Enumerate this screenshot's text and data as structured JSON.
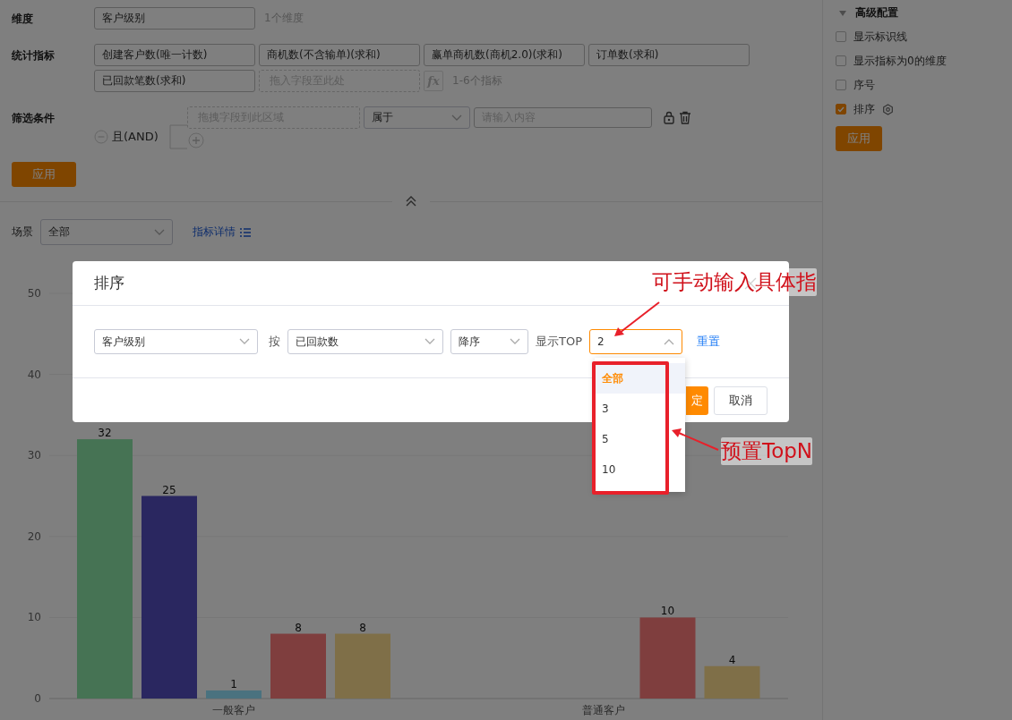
{
  "config": {
    "dimension": {
      "label": "维度",
      "tags": [
        "客户级别"
      ],
      "hint": "1个维度"
    },
    "metrics": {
      "label": "统计指标",
      "tags": [
        "创建客户数(唯一计数)",
        "商机数(不含输单)(求和)",
        "赢单商机数(商机2.0)(求和)",
        "订单数(求和)",
        "已回款笔数(求和)"
      ],
      "placeholder": "拖入字段至此处",
      "formula": "fx",
      "hint": "1-6个指标"
    },
    "filter": {
      "label": "筛选条件",
      "logic": "且(AND)",
      "conditions": [
        {
          "field_placeholder": "拖拽字段到此区域",
          "operator": "属于",
          "value_placeholder": "请输入内容"
        }
      ]
    },
    "apply": "应用"
  },
  "scene": {
    "label": "场景",
    "value": "全部",
    "link": "指标详情"
  },
  "chart": {
    "chart_data": {
      "type": "bar",
      "categories": [
        "一般客户",
        "普通客户"
      ],
      "ylim": [
        0,
        50
      ],
      "yticks": [
        0,
        10,
        20,
        30,
        40,
        50
      ],
      "data_labels": true,
      "grid": true,
      "series": [
        {
          "color": "#8ce6a8",
          "values": [
            32,
            null
          ]
        },
        {
          "color": "#544ec0",
          "values": [
            25,
            null
          ]
        },
        {
          "color": "#94e4ff",
          "values": [
            1,
            null
          ]
        },
        {
          "color": "#ff7c7c",
          "values": [
            8,
            10
          ]
        },
        {
          "color": "#ffde90",
          "values": [
            8,
            4
          ]
        }
      ]
    }
  },
  "advanced": {
    "title": "高级配置",
    "expanded": true,
    "options": [
      {
        "label": "显示标识线",
        "checked": false,
        "gear": false
      },
      {
        "label": "显示指标为0的维度",
        "checked": false,
        "gear": false
      },
      {
        "label": "序号",
        "checked": false,
        "gear": false
      },
      {
        "label": "排序",
        "checked": true,
        "gear": true
      }
    ],
    "apply": "应用"
  },
  "sort_dialog": {
    "title": "排序",
    "field": "客户级别",
    "by_label": "按",
    "metric": "已回款数",
    "order": "降序",
    "top_label": "显示TOP",
    "top_value": "2",
    "top_open": true,
    "reset": "重置",
    "confirm": "定",
    "cancel": "取消",
    "top_options": [
      {
        "label": "全部",
        "selected": true
      },
      {
        "label": "3",
        "selected": false
      },
      {
        "label": "5",
        "selected": false
      },
      {
        "label": "10",
        "selected": false
      }
    ]
  },
  "annotations": [
    {
      "text": "可手动输入具体指"
    },
    {
      "text": "预置TopN"
    }
  ]
}
